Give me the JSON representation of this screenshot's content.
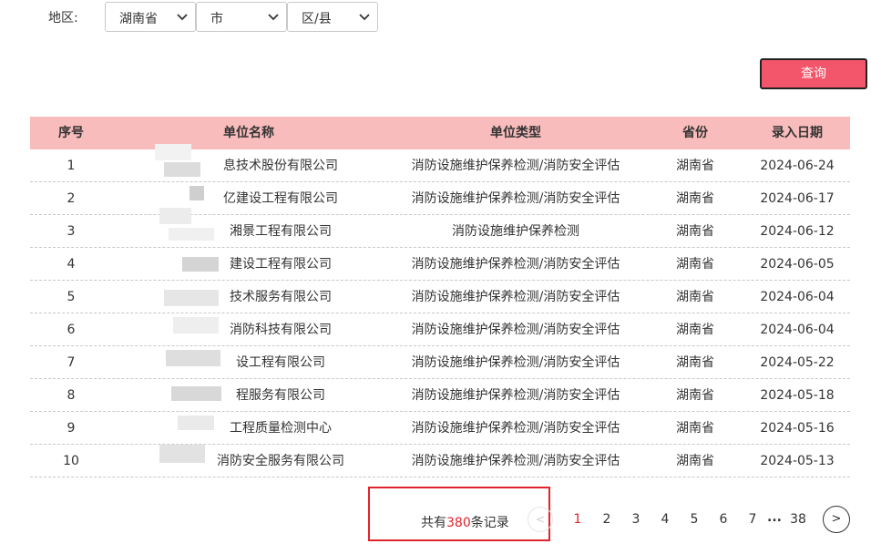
{
  "filter": {
    "region_label": "地区:",
    "province": "湖南省",
    "city": "市",
    "district": "区/县"
  },
  "query_button": "查询",
  "table": {
    "headers": [
      "序号",
      "单位名称",
      "单位类型",
      "省份",
      "录入日期"
    ],
    "rows": [
      {
        "no": "1",
        "name": "息技术股份有限公司",
        "type": "消防设施维护保养检测/消防安全评估",
        "province": "湖南省",
        "date": "2024-06-24"
      },
      {
        "no": "2",
        "name": "亿建设工程有限公司",
        "type": "消防设施维护保养检测/消防安全评估",
        "province": "湖南省",
        "date": "2024-06-17"
      },
      {
        "no": "3",
        "name": "湘景工程有限公司",
        "type": "消防设施维护保养检测",
        "province": "湖南省",
        "date": "2024-06-12"
      },
      {
        "no": "4",
        "name": "建设工程有限公司",
        "type": "消防设施维护保养检测/消防安全评估",
        "province": "湖南省",
        "date": "2024-06-05"
      },
      {
        "no": "5",
        "name": "技术服务有限公司",
        "type": "消防设施维护保养检测/消防安全评估",
        "province": "湖南省",
        "date": "2024-06-04"
      },
      {
        "no": "6",
        "name": "消防科技有限公司",
        "type": "消防设施维护保养检测/消防安全评估",
        "province": "湖南省",
        "date": "2024-06-04"
      },
      {
        "no": "7",
        "name": "设工程有限公司",
        "type": "消防设施维护保养检测/消防安全评估",
        "province": "湖南省",
        "date": "2024-05-22"
      },
      {
        "no": "8",
        "name": "程服务有限公司",
        "type": "消防设施维护保养检测/消防安全评估",
        "province": "湖南省",
        "date": "2024-05-18"
      },
      {
        "no": "9",
        "name": "工程质量检测中心",
        "type": "消防设施维护保养检测/消防安全评估",
        "province": "湖南省",
        "date": "2024-05-16"
      },
      {
        "no": "10",
        "name": "消防安全服务有限公司",
        "type": "消防设施维护保养检测/消防安全评估",
        "province": "湖南省",
        "date": "2024-05-13"
      }
    ]
  },
  "pagination": {
    "total_prefix": "共有",
    "total_count": "380",
    "total_suffix": "条记录",
    "prev": "<",
    "pages": [
      "1",
      "2",
      "3",
      "4",
      "5",
      "6",
      "7"
    ],
    "active_page": "1",
    "ellipsis": "...",
    "last_page": "38",
    "next": ">"
  },
  "colors": {
    "header_bg": "#f9bcbc",
    "button_bg": "#f3566a",
    "highlight": "#e0242b"
  }
}
